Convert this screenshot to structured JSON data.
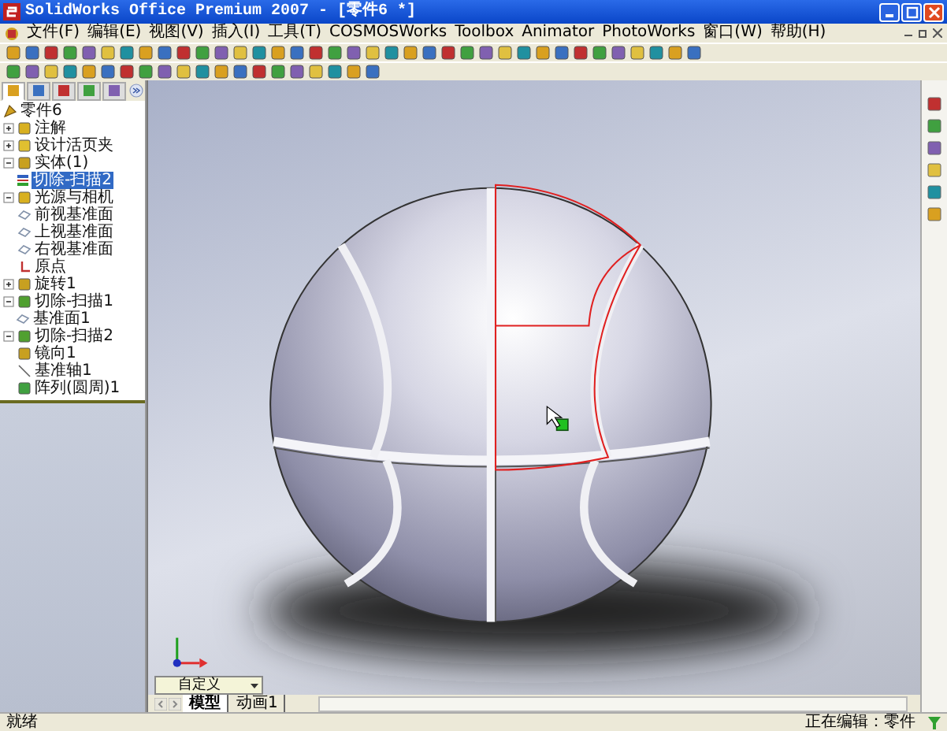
{
  "window": {
    "title": "SolidWorks Office Premium 2007 - [零件6 *]"
  },
  "menu": [
    {
      "label": "文件(F)"
    },
    {
      "label": "编辑(E)"
    },
    {
      "label": "视图(V)"
    },
    {
      "label": "插入(I)"
    },
    {
      "label": "工具(T)"
    },
    {
      "label": "COSMOSWorks"
    },
    {
      "label": "Toolbox"
    },
    {
      "label": "Animator"
    },
    {
      "label": "PhotoWorks"
    },
    {
      "label": "窗口(W)"
    },
    {
      "label": "帮助(H)"
    }
  ],
  "panel_tabs": [
    {
      "selected": true
    },
    {
      "selected": false
    },
    {
      "selected": false
    },
    {
      "selected": false
    },
    {
      "selected": false
    }
  ],
  "feature_tree": {
    "root": "零件6",
    "items": [
      {
        "label": "注解",
        "kind": "annotation",
        "expanded": false
      },
      {
        "label": "设计活页夹",
        "kind": "binder",
        "expanded": false
      },
      {
        "label": "实体(1)",
        "kind": "solid",
        "expanded": true,
        "children": [
          {
            "label": "切除-扫描2",
            "kind": "body",
            "selected": true
          }
        ]
      },
      {
        "label": "光源与相机",
        "kind": "folder",
        "expanded": true
      },
      {
        "label": "前视基准面",
        "kind": "plane"
      },
      {
        "label": "上视基准面",
        "kind": "plane"
      },
      {
        "label": "右视基准面",
        "kind": "plane"
      },
      {
        "label": "原点",
        "kind": "origin"
      },
      {
        "label": "旋转1",
        "kind": "revolve",
        "expanded": false
      },
      {
        "label": "切除-扫描1",
        "kind": "cut",
        "expanded": true,
        "children": [
          {
            "label": "基准面1",
            "kind": "plane",
            "selected": false
          }
        ]
      },
      {
        "label": "切除-扫描2",
        "kind": "cut",
        "expanded": true
      },
      {
        "label": "镜向1",
        "kind": "mirror"
      },
      {
        "label": "基准轴1",
        "kind": "axis"
      },
      {
        "label": "阵列(圆周)1",
        "kind": "pattern"
      }
    ]
  },
  "view_selector": {
    "value": "自定义"
  },
  "bottom_tabs": [
    {
      "label": "模型",
      "selected": true
    },
    {
      "label": "动画1",
      "selected": false
    }
  ],
  "status_bar": {
    "left": "就绪",
    "right": "正在编辑：零件"
  }
}
